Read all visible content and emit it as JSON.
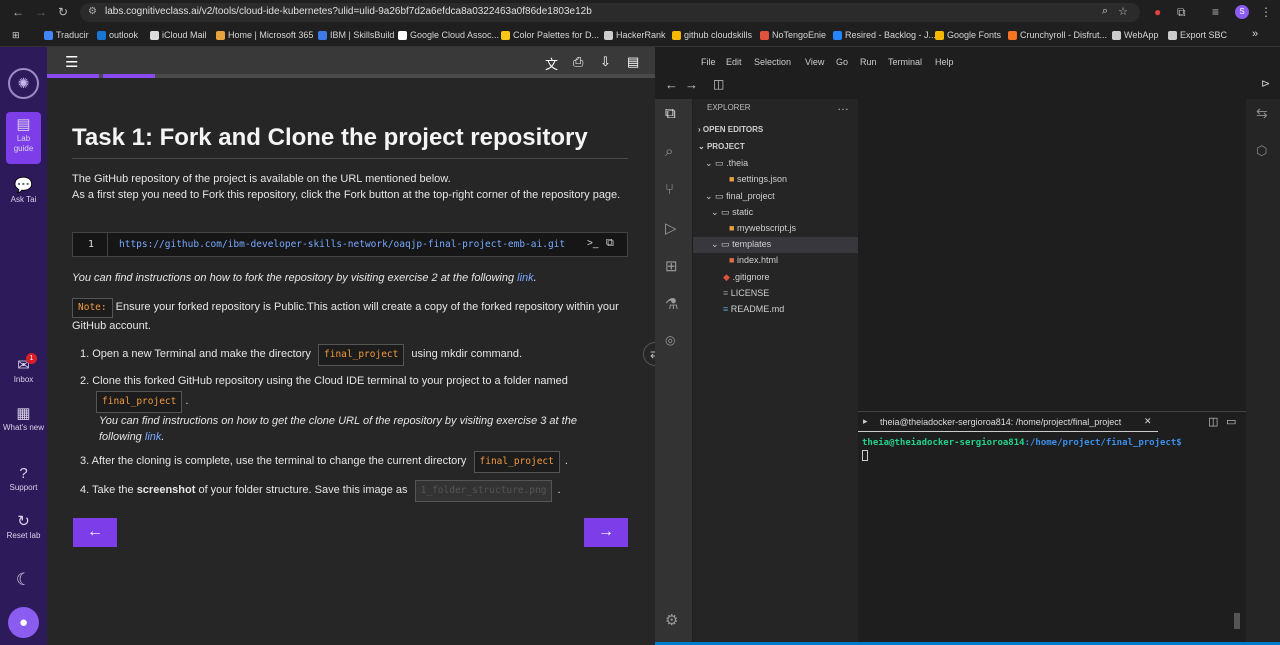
{
  "browser": {
    "url": "labs.cognitiveclass.ai/v2/tools/cloud-ide-kubernetes?ulid=ulid-9a26bf7d2a6efdca8a0322463a0f86de1803e12b",
    "profile_initial": "S",
    "bookmarks": [
      "Traducir",
      "outlook",
      "iCloud Mail",
      "Home | Microsoft 365",
      "IBM | SkillsBuild",
      "Google Cloud Assoc...",
      "Color Palettes for D...",
      "HackerRank",
      "github cloudskills",
      "NoTengoEnie",
      "Resired - Backlog - J...",
      "Google Fonts",
      "Crunchyroll - Disfrut...",
      "WebApp",
      "Export SBC"
    ]
  },
  "rail": {
    "items": [
      {
        "label": "Lab guide"
      },
      {
        "label": "Ask Tai"
      },
      {
        "label": "Inbox",
        "badge": "1"
      },
      {
        "label": "What's new"
      },
      {
        "label": "Support"
      },
      {
        "label": "Reset lab"
      }
    ]
  },
  "guide": {
    "title": "Task 1: Fork and Clone the project repository",
    "p1": "The GitHub repository of the project is available on the URL mentioned below.",
    "p2": "As a first step you need to Fork this repository, click the Fork button at the top-right corner of the repository page.",
    "code_line_no": "1",
    "code_url": "https://github.com/ibm-developer-skills-network/oaqjp-final-project-emb-ai.git",
    "p3": "You can find instructions on how to fork the repository by visiting exercise 2 at the following ",
    "link": "link",
    "note_label": "Note:",
    "note_text": " Ensure your forked repository is Public.This action will create a copy of the forked repository within your GitHub account.",
    "step1_a": "Open a new Terminal and make the directory",
    "step1_code": "final_project",
    "step1_b": "using mkdir command.",
    "step2_a": "Clone this forked GitHub repository using the Cloud IDE terminal to your project to a folder named",
    "step2_code": "final_project",
    "step2_b": "You can find instructions on how to get the clone URL of the repository by visiting exercise 3 at the following",
    "step3_a": "After the cloning is complete, use the terminal to change the current directory",
    "step3_code": "final_project",
    "step4_a": "Take the",
    "step4_bold": "screenshot",
    "step4_b": "of your folder structure. Save this image as",
    "step4_code": "1_folder_structure.png",
    "prev_btn": "←",
    "next_btn": "→"
  },
  "ide": {
    "menu": [
      "File",
      "Edit",
      "Selection",
      "View",
      "Go",
      "Run",
      "Terminal",
      "Help"
    ],
    "explorer_title": "EXPLORER",
    "open_editors": "OPEN EDITORS",
    "project": "PROJECT",
    "tree": [
      ".theia",
      "settings.json",
      "final_project",
      "static",
      "mywebscript.js",
      "templates",
      "index.html",
      ".gitignore",
      "LICENSE",
      "README.md"
    ],
    "terminal_tab": "theia@theiadocker-sergioroa814: /home/project/final_project",
    "prompt_user": "theia@theiadocker-sergioroa814",
    "prompt_path": ":/home/project/final_project$"
  }
}
